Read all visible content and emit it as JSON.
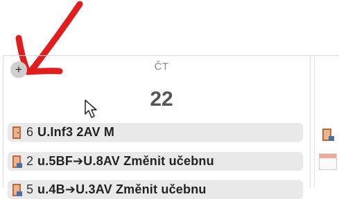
{
  "calendar": {
    "add_label": "+",
    "day_name": "ČT",
    "day_number": "22"
  },
  "events": [
    {
      "count": "6",
      "text": "U.Inf3 2AV M",
      "icon": "door-icon"
    },
    {
      "count": "2",
      "text": "u.5BF➔U.8AV Změnit učebnu",
      "icon": "door-move-icon"
    },
    {
      "count": "5",
      "text": "u.4B➔U.3AV Změnit učebnu",
      "icon": "door-move-icon"
    }
  ],
  "colors": {
    "annotation_arrow": "#e11d1d",
    "door": "#c0663a",
    "door_move_badge": "#4a6fa5",
    "add_button": "#cfcfcf"
  }
}
